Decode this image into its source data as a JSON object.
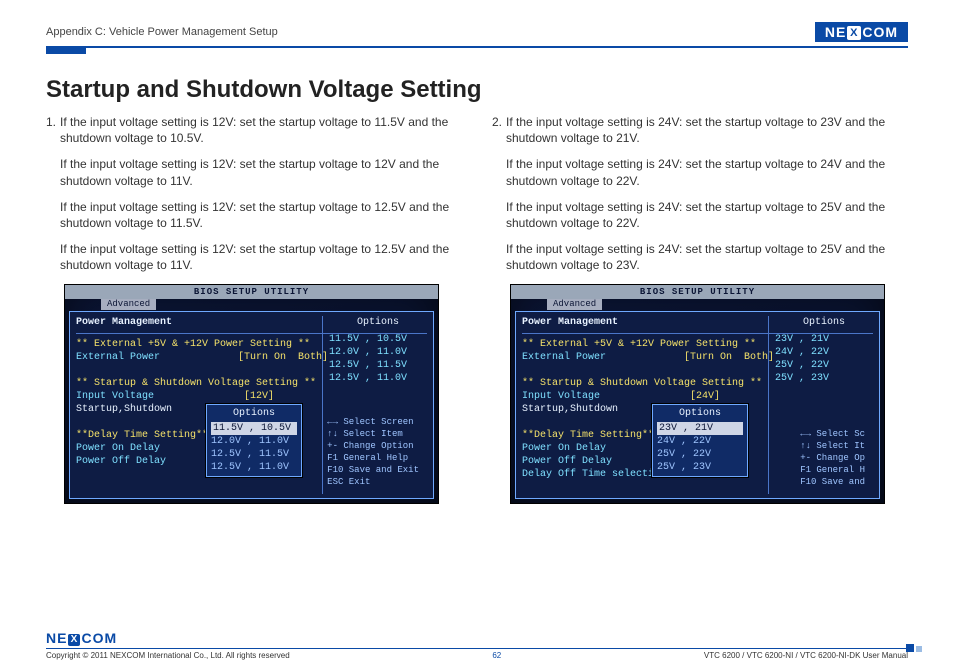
{
  "header": {
    "appendix": "Appendix C: Vehicle Power Management Setup",
    "brand_left": "NE",
    "brand_x": "X",
    "brand_right": "COM"
  },
  "title": "Startup and Shutdown Voltage Setting",
  "left_col": {
    "item_no": "1.",
    "p1": "If the input voltage setting is 12V: set the startup voltage to 11.5V and the shutdown voltage to 10.5V.",
    "p2": "If the input voltage setting is 12V: set the startup voltage to 12V and the shutdown voltage to 11V.",
    "p3": "If the input voltage setting is 12V: set the startup voltage to 12.5V and the shutdown voltage to 11.5V.",
    "p4": "If the input voltage setting is 12V: set the startup voltage to 12.5V and the shutdown voltage to 11V."
  },
  "right_col": {
    "item_no": "2.",
    "p1": "If the input voltage setting is 24V: set the startup voltage to 23V and the shutdown voltage to 21V.",
    "p2": "If the input voltage setting is 24V: set the startup voltage to 24V and the shutdown voltage to 22V.",
    "p3": "If the input voltage setting is 24V: set the startup voltage to 25V and the shutdown voltage to 22V.",
    "p4": "If the input voltage setting is 24V: set the startup voltage to 25V and the shutdown voltage to 23V."
  },
  "bios_common": {
    "util_title": "BIOS SETUP UTILITY",
    "tab": "Advanced",
    "pm_title": "Power Management",
    "options_hdr": "Options",
    "ext_power_hdr": "** External +5V & +12V Power Setting **",
    "ext_power_row": "External Power",
    "ext_power_val": "[Turn On  Both]",
    "ss_hdr": "** Startup & Shutdown Voltage Setting **",
    "input_row": "Input Voltage",
    "ss_row": "Startup,Shutdown",
    "delay_hdr": "**Delay Time Setting**",
    "pon": "Power On Delay",
    "poff": "Power Off Delay",
    "doff": "Delay Off Time selection",
    "popup_hdr": "Options"
  },
  "bios_left": {
    "input_val": "[12V]",
    "opts": [
      "11.5V , 10.5V",
      "12.0V , 11.0V",
      "12.5V , 11.5V",
      "12.5V , 11.0V"
    ],
    "popup": [
      "11.5V , 10.5V",
      "12.0V , 11.0V",
      "12.5V , 11.5V",
      "12.5V , 11.0V"
    ],
    "hints": [
      "←→   Select Screen",
      "↑↓   Select Item",
      "+-   Change Option",
      "F1   General Help",
      "F10  Save and Exit",
      "ESC  Exit"
    ]
  },
  "bios_right": {
    "input_val": "[24V]",
    "opts": [
      "23V , 21V",
      "24V , 22V",
      "25V , 22V",
      "25V , 23V"
    ],
    "popup": [
      "23V , 21V",
      "24V , 22V",
      "25V , 22V",
      "25V , 23V"
    ],
    "hints": [
      "←→   Select Sc",
      "↑↓   Select It",
      "+-   Change Op",
      "F1   General H",
      "F10  Save and"
    ]
  },
  "footer": {
    "copyright": "Copyright © 2011 NEXCOM International Co., Ltd. All rights reserved",
    "page": "62",
    "manual": "VTC 6200 / VTC 6200-NI / VTC 6200-NI-DK User Manual"
  }
}
